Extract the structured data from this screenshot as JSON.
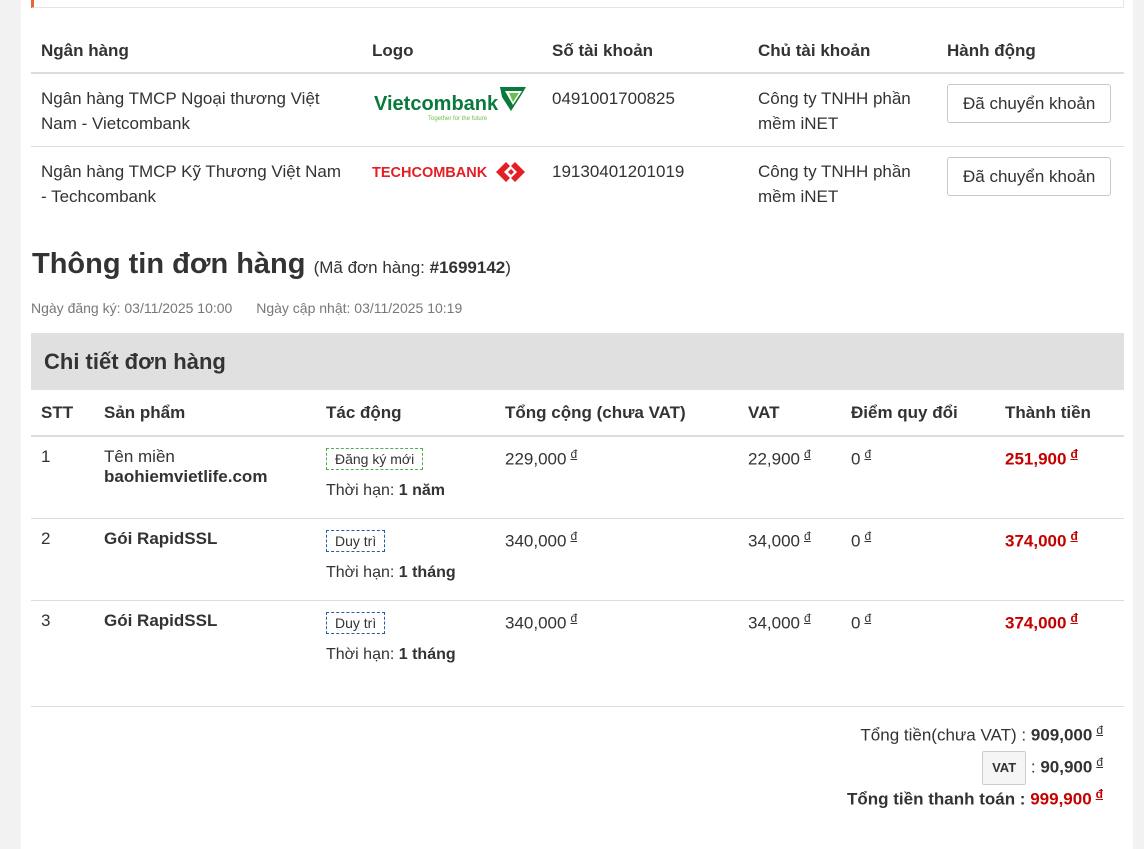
{
  "bank_table": {
    "headers": [
      "Ngân hàng",
      "Logo",
      "Số tài khoản",
      "Chủ tài khoản",
      "Hành động"
    ],
    "rows": [
      {
        "bank_line1": "Ngân hàng TMCP Ngoại thương Việt",
        "bank_line2": "Nam - Vietcombank",
        "logo": "vietcombank-logo",
        "logo_text": "Vietcombank",
        "logo_tagline": "Together for the future",
        "account": "0491001700825",
        "owner_line1": "Công ty TNHH phần",
        "owner_line2": "mềm iNET",
        "action": "Đã chuyển khoản"
      },
      {
        "bank_line1": "Ngân hàng TMCP Kỹ Thương Việt Nam",
        "bank_line2": "- Techcombank",
        "logo": "techcombank-logo",
        "logo_text": "TECHCOMBANK",
        "account": "19130401201019",
        "owner_line1": "Công ty TNHH phần",
        "owner_line2": "mềm iNET",
        "action": "Đã chuyển khoản"
      }
    ]
  },
  "order": {
    "title": "Thông tin đơn hàng",
    "code_prefix": "(Mã đơn hàng: ",
    "code": "#1699142",
    "code_suffix": ")",
    "registered": "Ngày đăng ký: 03/11/2025 10:00",
    "updated": "Ngày cập nhật: 03/11/2025 10:19"
  },
  "detail": {
    "heading": "Chi tiết đơn hàng",
    "headers": [
      "STT",
      "Sản phẩm",
      "Tác động",
      "Tổng cộng (chưa VAT)",
      "VAT",
      "Điểm quy đổi",
      "Thành tiền"
    ],
    "currency": "đ",
    "term_label": "Thời hạn: ",
    "rows": [
      {
        "stt": "1",
        "product_prefix": "Tên miền",
        "product": "baohiemvietlife.com",
        "action": "Đăng ký mới",
        "term": "1 năm",
        "subtotal": "229,000",
        "vat": "22,900",
        "points": "0",
        "total": "251,900"
      },
      {
        "stt": "2",
        "product_prefix": "",
        "product": "Gói RapidSSL",
        "action": "Duy trì",
        "term": "1 tháng",
        "subtotal": "340,000",
        "vat": "34,000",
        "points": "0",
        "total": "374,000"
      },
      {
        "stt": "3",
        "product_prefix": "",
        "product": "Gói RapidSSL",
        "action": "Duy trì",
        "term": "1 tháng",
        "subtotal": "340,000",
        "vat": "34,000",
        "points": "0",
        "total": "374,000"
      }
    ]
  },
  "totals": {
    "subtotal_label": "Tổng tiền(chưa VAT) : ",
    "subtotal": "909,000",
    "vat_label": "VAT",
    "vat_sep": " : ",
    "vat": "90,900",
    "grand_label": "Tổng tiền thanh toán : ",
    "grand": "999,900"
  },
  "colors": {
    "accent": "#e8652c",
    "price_red": "#c40000",
    "vcb_green": "#0a7a3c",
    "tcb_red": "#e31e24"
  }
}
